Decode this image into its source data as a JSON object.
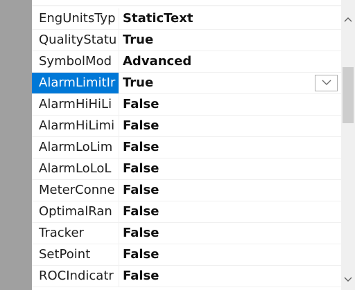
{
  "properties": [
    {
      "name": "EngUnitsTyp",
      "value": "StaticText"
    },
    {
      "name": "QualityStatu",
      "value": "True"
    },
    {
      "name": "SymbolMod",
      "value": "Advanced"
    },
    {
      "name": "AlarmLimitIr",
      "value": "True",
      "selected": true
    },
    {
      "name": "AlarmHiHiLi",
      "value": "False"
    },
    {
      "name": "AlarmHiLimi",
      "value": "False"
    },
    {
      "name": "AlarmLoLim",
      "value": "False"
    },
    {
      "name": "AlarmLoLoL",
      "value": "False"
    },
    {
      "name": "MeterConne",
      "value": "False"
    },
    {
      "name": "OptimalRan",
      "value": "False"
    },
    {
      "name": "Tracker",
      "value": "False"
    },
    {
      "name": "SetPoint",
      "value": "False"
    },
    {
      "name": "ROCIndicatr",
      "value": "False"
    }
  ],
  "icons": {
    "dropdown": "chevron-down-icon",
    "scroll_up": "scroll-up-icon",
    "scroll_down": "scroll-down-icon"
  },
  "colors": {
    "selection": "#0078d7",
    "category_strip": "#a0a0a0"
  }
}
